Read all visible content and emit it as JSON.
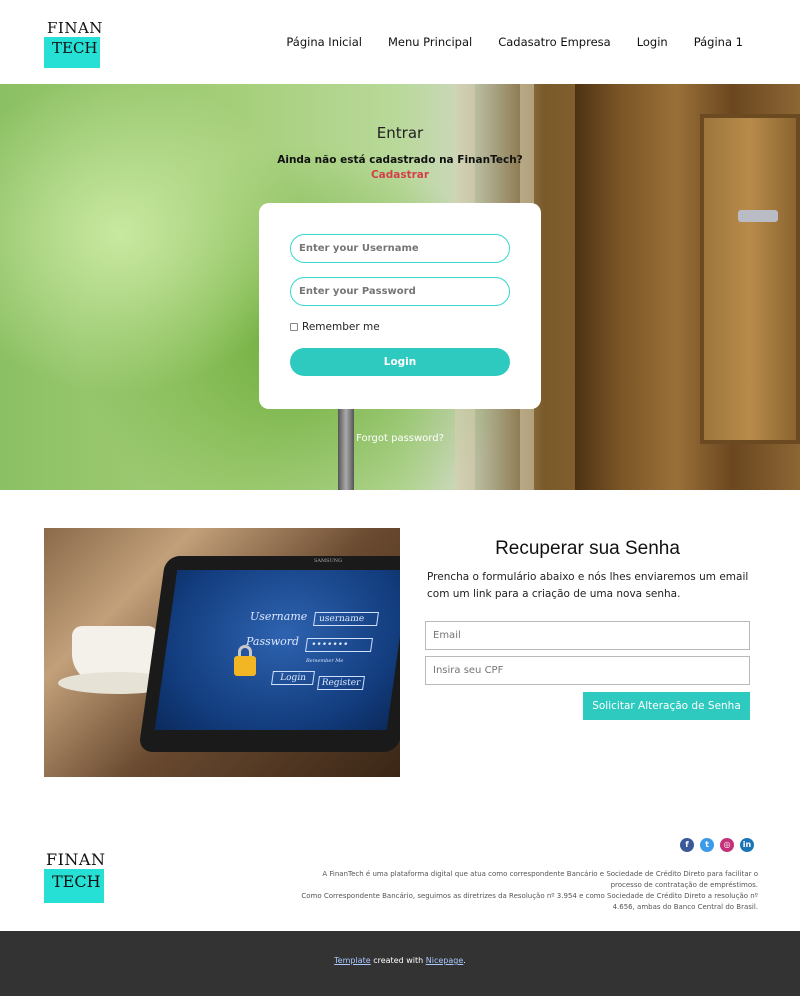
{
  "brand": {
    "logo_top": "FINAN",
    "logo_bottom": "TECH",
    "accent": "#26e0d6"
  },
  "nav": [
    {
      "label": "Página Inicial"
    },
    {
      "label": "Menu Principal"
    },
    {
      "label": "Cadasatro Empresa"
    },
    {
      "label": "Login"
    },
    {
      "label": "Página 1"
    }
  ],
  "hero": {
    "title": "Entrar",
    "question": "Ainda não está cadastrado na FinanTech?",
    "register_link": "Cadastrar",
    "register_color": "#d3404a"
  },
  "login": {
    "username_placeholder": "Enter your Username",
    "password_placeholder": "Enter your Password",
    "remember_label": "Remember me",
    "submit_label": "Login",
    "button_color": "#2ec9bf",
    "forgot_label": "Forgot password?"
  },
  "illustration": {
    "username_label": "Username",
    "username_box": "username",
    "password_label": "Password",
    "password_box": "•••••••",
    "remember_text": "Remember Me",
    "login_btn": "Login",
    "register_btn": "Register",
    "brand": "SAMSUNG"
  },
  "recover": {
    "title": "Recuperar sua Senha",
    "description": "Prencha o formulário abaixo e nós lhes enviaremos um email com um link para a criação de uma nova senha.",
    "email_placeholder": "Email",
    "cpf_placeholder": "Insira seu CPF",
    "submit_label": "Solicitar Alteração de Senha"
  },
  "footer": {
    "socials": [
      {
        "name": "facebook-icon",
        "glyph": "f"
      },
      {
        "name": "twitter-icon",
        "glyph": "t"
      },
      {
        "name": "instagram-icon",
        "glyph": "◎"
      },
      {
        "name": "linkedin-icon",
        "glyph": "in"
      }
    ],
    "legal_1": "A FinanTech é uma plataforma digital que atua como correspondente Bancário e Sociedade de Crédito Direto para facilitar o processo de contratação de empréstimos.",
    "legal_2": "Como Correspondente Bancário, seguimos as diretrizes da Resolução nº 3.954 e como Sociedade de Crédito Direto a resolução nº 4.656, ambas do Banco Central do Brasil.",
    "credit_template": "Template",
    "credit_middle": "created with",
    "credit_nicepage": "Nicepage",
    "credit_end": "."
  }
}
